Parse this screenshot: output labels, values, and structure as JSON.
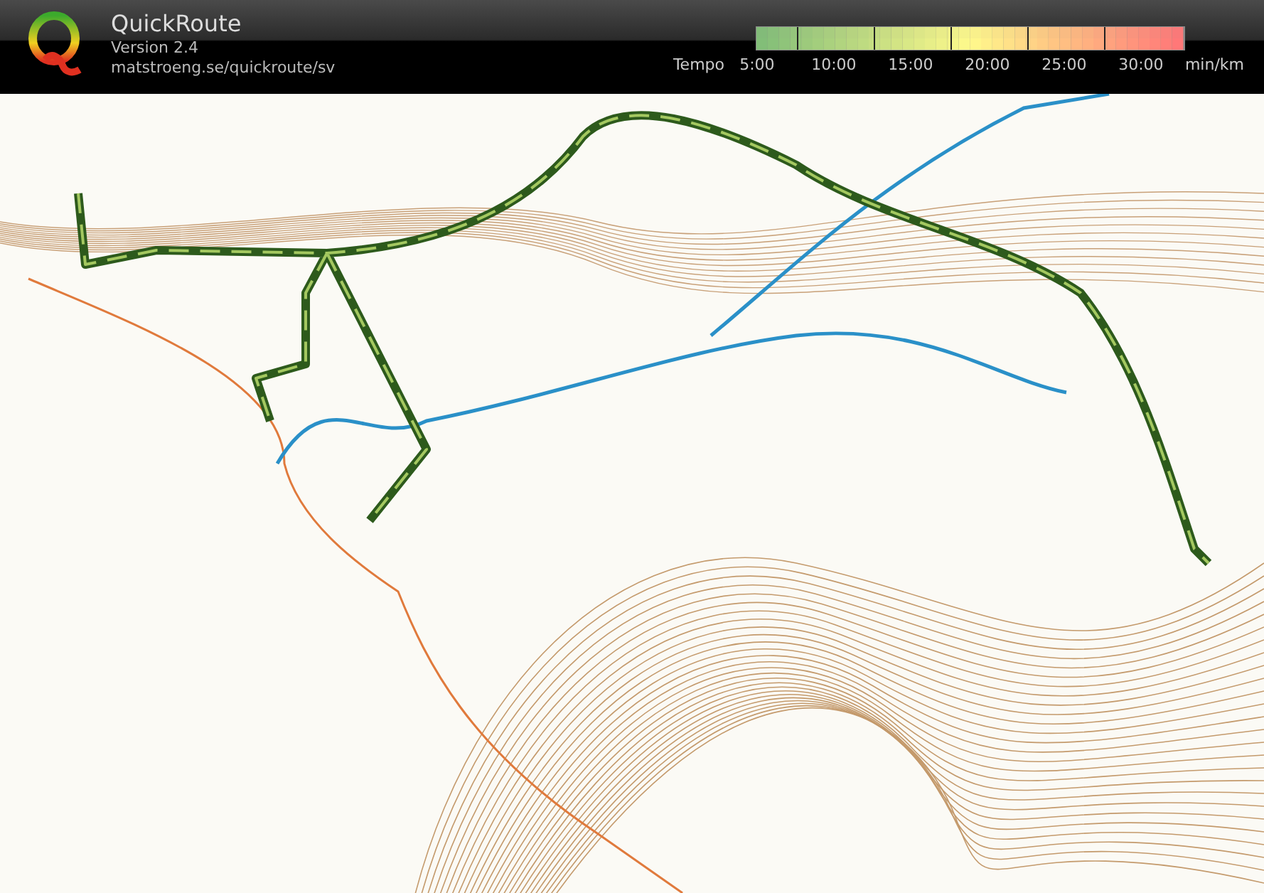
{
  "app": {
    "title": "QuickRoute",
    "version": "Version 2.4",
    "url": "matstroeng.se/quickroute/sv"
  },
  "legend": {
    "label": "Tempo",
    "ticks": [
      "5:00",
      "10:00",
      "15:00",
      "20:00",
      "25:00",
      "30:00"
    ],
    "unit": "min/km"
  }
}
